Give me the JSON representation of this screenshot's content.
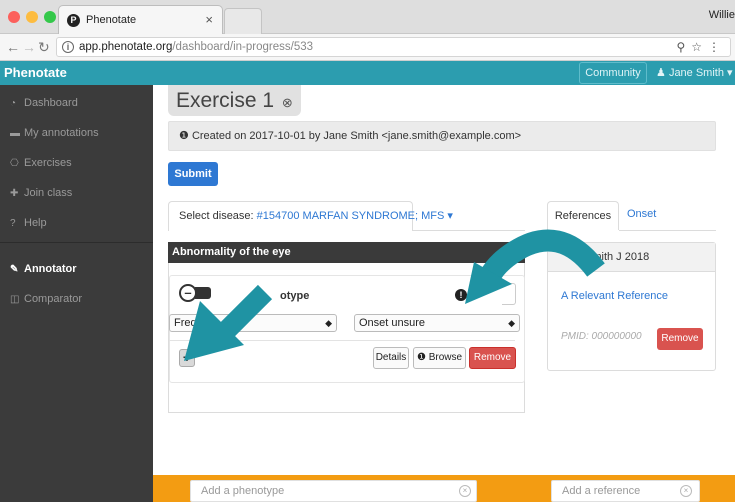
{
  "browser": {
    "tab_title": "Phenotate",
    "tab_favicon": "P",
    "close_glyph": "×",
    "user_name": "Willie",
    "url_host": "app.phenotate.org",
    "url_path": "/dashboard/in-progress/533"
  },
  "navbar": {
    "brand": "Phenotate",
    "community": "Community",
    "user": "Jane Smith"
  },
  "sidebar": {
    "items": [
      {
        "label": "Dashboard",
        "icon": "dashboard-icon"
      },
      {
        "label": "My annotations",
        "icon": "folder-icon"
      },
      {
        "label": "Exercises",
        "icon": "exercises-icon"
      },
      {
        "label": "Join class",
        "icon": "plus-icon"
      },
      {
        "label": "Help",
        "icon": "question-icon"
      },
      {
        "label": "Annotator",
        "icon": "pencil-icon"
      },
      {
        "label": "Comparator",
        "icon": "columns-icon"
      }
    ]
  },
  "main": {
    "title": "Exercise 1",
    "created": "Created on 2017-10-01 by Jane Smith <jane.smith@example.com>",
    "submit": "Submit",
    "disease_label": "Select disease:",
    "disease_value": "#154700 MARFAN SYNDROME; MFS",
    "section_header": "Abnormality of the eye",
    "phenotype_label_visible": "otype",
    "frequency_value": "Freq",
    "onset_value": "Onset unsure",
    "details": "Details",
    "browse": "Browse",
    "remove": "Remove"
  },
  "references": {
    "tab_references": "References",
    "tab_onset": "Onset",
    "header_visible": "Smith J 2018",
    "link": "A Relevant Reference",
    "pmid": "PMID: 000000000",
    "remove": "Remove"
  },
  "footer": {
    "phenotype_placeholder": "Add a phenotype",
    "reference_placeholder": "Add a reference"
  },
  "colors": {
    "navbar": "#2c9daf",
    "arrow": "#1f93a3",
    "sidebar": "#3b3b3b",
    "footer": "#f39c12",
    "primary": "#2e78d3",
    "danger": "#d9534f"
  }
}
